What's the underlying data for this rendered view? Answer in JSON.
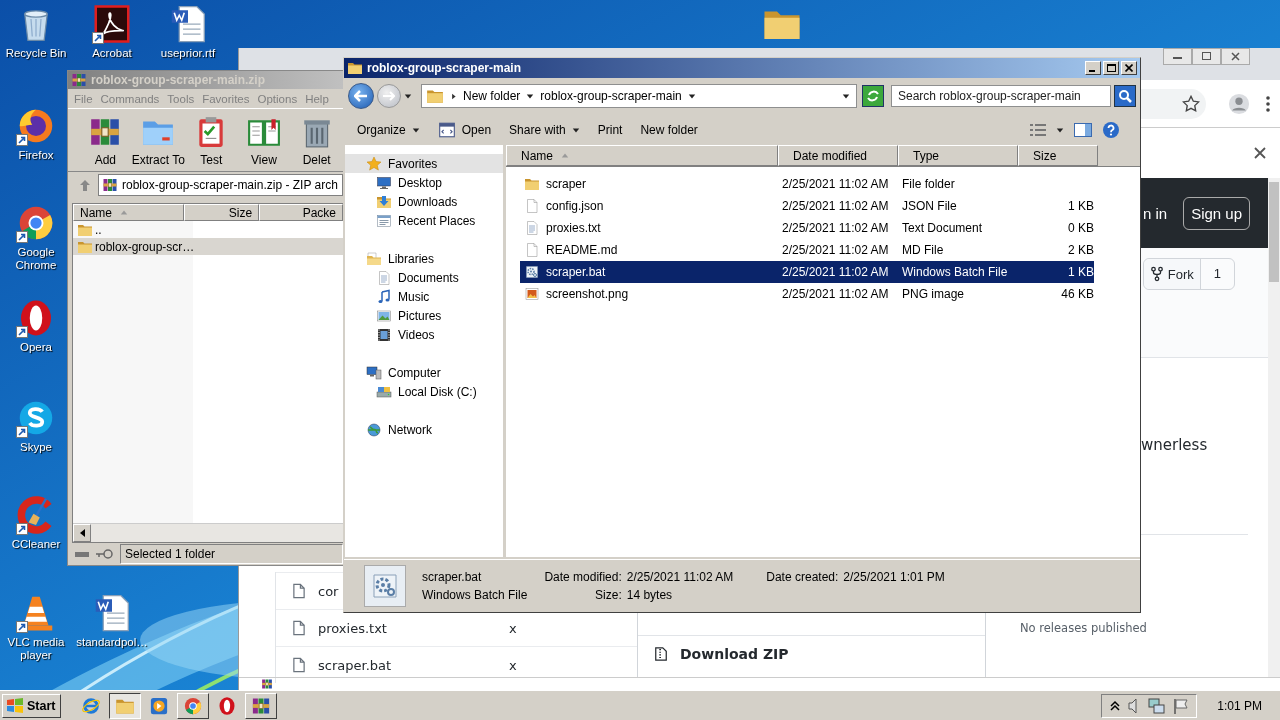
{
  "desktop": {
    "icons": [
      {
        "label": "Recycle Bin",
        "kind": "recycle",
        "shortcut": false
      },
      {
        "label": "Acrobat",
        "kind": "acrobat",
        "shortcut": true
      },
      {
        "label": "useprior.rtf",
        "kind": "word",
        "shortcut": false
      },
      {
        "label": "Firefox",
        "kind": "firefox",
        "shortcut": true
      },
      {
        "label": "Google Chrome",
        "kind": "chrome",
        "shortcut": true
      },
      {
        "label": "Opera",
        "kind": "opera",
        "shortcut": true
      },
      {
        "label": "Skype",
        "kind": "skype",
        "shortcut": true
      },
      {
        "label": "CCleaner",
        "kind": "ccleaner",
        "shortcut": true
      },
      {
        "label": "VLC media player",
        "kind": "vlc",
        "shortcut": true
      },
      {
        "label": "standardpol…",
        "kind": "word",
        "shortcut": false
      },
      {
        "kind": "folder",
        "shortcut": false
      }
    ]
  },
  "browser": {
    "nav": {
      "sign_in": "n in",
      "sign_up": "Sign up"
    },
    "fork": {
      "label": "Fork",
      "count": "1"
    },
    "about": "wnerless",
    "files": [
      {
        "name": "cor"
      },
      {
        "name": "proxies.txt",
        "mark": "x"
      },
      {
        "name": "scraper.bat",
        "mark": "x"
      }
    ],
    "code_menu": {
      "download": "Download ZIP"
    },
    "releases": "No releases published"
  },
  "winrar": {
    "title": "roblox-group-scraper-main.zip",
    "active": false,
    "menu": [
      "File",
      "Commands",
      "Tools",
      "Favorites",
      "Options",
      "Help"
    ],
    "tools": [
      {
        "label": "Add",
        "kind": "add"
      },
      {
        "label": "Extract To",
        "kind": "extract"
      },
      {
        "label": "Test",
        "kind": "test"
      },
      {
        "label": "View",
        "kind": "view"
      },
      {
        "label": "Delet",
        "kind": "delete"
      }
    ],
    "path": "roblox-group-scraper-main.zip - ZIP arch",
    "columns": [
      {
        "label": "Name",
        "sorted": true
      },
      {
        "label": "Size",
        "sorted": false
      },
      {
        "label": "Packe",
        "sorted": false
      }
    ],
    "rows": [
      {
        "name": "..",
        "selected": false
      },
      {
        "name": "roblox-group-scr…",
        "selected": true
      }
    ],
    "status": "Selected 1 folder"
  },
  "explorer": {
    "title": "roblox-group-scraper-main",
    "active": true,
    "breadcrumbs": [
      "New folder",
      "roblox-group-scraper-main"
    ],
    "search": {
      "placeholder": "Search roblox-group-scraper-main"
    },
    "toolbar": [
      {
        "label": "Organize",
        "kind": "menu"
      },
      {
        "label": "Open",
        "kind": "open"
      },
      {
        "label": "Share with",
        "kind": "menu"
      },
      {
        "label": "Print",
        "kind": "plain"
      },
      {
        "label": "New folder",
        "kind": "plain"
      }
    ],
    "nav": [
      {
        "label": "Favorites",
        "kind": "star",
        "selected": true,
        "children": [
          {
            "label": "Desktop",
            "kind": "monitor",
            "selected": false
          },
          {
            "label": "Downloads",
            "kind": "downloads",
            "selected": false
          },
          {
            "label": "Recent Places",
            "kind": "recent",
            "selected": false
          }
        ]
      },
      {
        "label": "Libraries",
        "kind": "libraries",
        "selected": false,
        "children": [
          {
            "label": "Documents",
            "kind": "textdoc",
            "selected": false
          },
          {
            "label": "Music",
            "kind": "music",
            "selected": false
          },
          {
            "label": "Pictures",
            "kind": "pictures",
            "selected": false
          },
          {
            "label": "Videos",
            "kind": "videos",
            "selected": false
          }
        ]
      },
      {
        "label": "Computer",
        "kind": "computer",
        "selected": false,
        "children": [
          {
            "label": "Local Disk (C:)",
            "kind": "disk",
            "selected": false
          }
        ]
      },
      {
        "label": "Network",
        "kind": "network",
        "selected": false
      }
    ],
    "columns": [
      {
        "label": "Name",
        "sorted": true
      },
      {
        "label": "Date modified",
        "sorted": false
      },
      {
        "label": "Type",
        "sorted": false
      },
      {
        "label": "Size",
        "sorted": false
      }
    ],
    "rows": [
      {
        "name": "scraper",
        "kind": "folder",
        "date": "2/25/2021 11:02 AM",
        "type": "File folder",
        "selected": false
      },
      {
        "name": "config.json",
        "kind": "doc",
        "date": "2/25/2021 11:02 AM",
        "type": "JSON File",
        "size": "1 KB",
        "selected": false
      },
      {
        "name": "proxies.txt",
        "kind": "textdoc",
        "date": "2/25/2021 11:02 AM",
        "type": "Text Document",
        "size": "0 KB",
        "selected": false
      },
      {
        "name": "README.md",
        "kind": "doc",
        "date": "2/25/2021 11:02 AM",
        "type": "MD File",
        "size": "2 KB",
        "selected": false
      },
      {
        "name": "scraper.bat",
        "kind": "bat",
        "date": "2/25/2021 11:02 AM",
        "type": "Windows Batch File",
        "size": "1 KB",
        "selected": true
      },
      {
        "name": "screenshot.png",
        "kind": "png",
        "date": "2/25/2021 11:02 AM",
        "type": "PNG image",
        "size": "46 KB",
        "selected": false
      }
    ],
    "details": {
      "name": "scraper.bat",
      "kind": "bat",
      "type": "Windows Batch File",
      "fields": [
        {
          "label": "Date modified:",
          "value": "2/25/2021 11:02 AM"
        },
        {
          "label": "Size:",
          "value": "14 bytes"
        },
        {
          "label": "Date created:",
          "value": "2/25/2021 1:01 PM"
        }
      ]
    }
  },
  "taskbar": {
    "start": "Start",
    "apps": [
      {
        "kind": "ie",
        "running": false,
        "selected": false
      },
      {
        "kind": "folder",
        "running": true,
        "selected": true
      },
      {
        "kind": "media",
        "running": false,
        "selected": false
      },
      {
        "kind": "chrome",
        "running": true,
        "selected": false
      },
      {
        "kind": "opera",
        "running": false,
        "selected": false
      },
      {
        "kind": "add",
        "running": true,
        "selected": false
      }
    ],
    "clock": "1:01 PM"
  }
}
